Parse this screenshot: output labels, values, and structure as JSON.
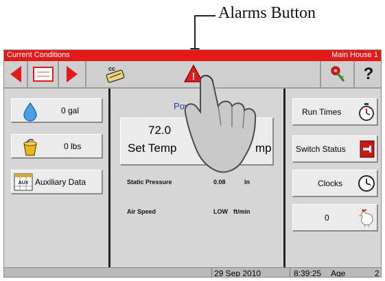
{
  "annotation": {
    "label": "Alarms Button"
  },
  "title_bar": {
    "left": "Current Conditions",
    "right": "Main House 1"
  },
  "toolbar": {
    "icons": [
      "prev-arrow-icon",
      "list-icon",
      "next-arrow-icon",
      "cc-icon",
      "alarm-warning-icon",
      "key-icon",
      "help-icon"
    ],
    "help_label": "?",
    "cc_label": "cc",
    "alarm_glyph": "!"
  },
  "left_panel": {
    "water": {
      "value": "0 gal",
      "icon": "water-drop-icon"
    },
    "feed": {
      "value": "0 lbs",
      "icon": "feed-bucket-icon"
    },
    "auxiliary": {
      "label": "Auxiliary Data",
      "icon_text": "AUX"
    }
  },
  "center_panel": {
    "power_label": "Pow",
    "temp": {
      "value": "72.0",
      "set_label": "Set Temp",
      "partial_label": "mp"
    },
    "readings": [
      {
        "label": "Static Pressure",
        "value": "0.08",
        "unit": "In"
      },
      {
        "label": "Air Speed",
        "value": "LOW",
        "unit": "ft/min"
      }
    ]
  },
  "right_panel": {
    "run_times": {
      "label": "Run Times",
      "icon": "stopwatch-icon"
    },
    "switch_status": {
      "label": "Switch Status",
      "icon": "switch-icon"
    },
    "clocks": {
      "label": "Clocks",
      "icon": "clock-icon"
    },
    "birds": {
      "value": "0",
      "icon": "chicken-icon"
    }
  },
  "status_bar": {
    "date": "29 Sep 2010",
    "time": "8:39:25",
    "age_label": "Age",
    "age_value": "2"
  },
  "colors": {
    "accent": "#e21a1a",
    "panel": "#d6d6d6",
    "button": "#ebebeb",
    "power_text": "#2a3aa8"
  }
}
